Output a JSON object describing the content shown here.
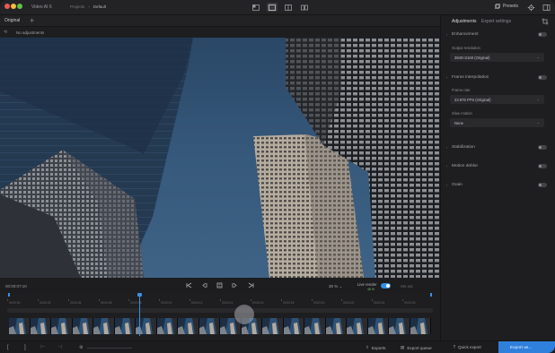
{
  "app": {
    "title": "Video AI 6"
  },
  "breadcrumbs": [
    "Projects",
    "›",
    "Default"
  ],
  "toolbar": {
    "presets_label": "Presets"
  },
  "preview": {
    "tab_label": "Original",
    "add_tab": "+",
    "adjust_status": "No adjustments"
  },
  "panel": {
    "tabs": [
      "Adjustments",
      "Export settings"
    ],
    "sections": {
      "enhancement": "Enhancement",
      "output_resolution_label": "Output resolution",
      "output_resolution_value": "3840×2160 (Original)",
      "frame_interpolation": "Frame interpolation",
      "frame_rate_label": "Frame rate",
      "frame_rate_value": "23.976 FPS (Original)",
      "slow_motion_label": "Slow motion",
      "slow_motion_value": "None",
      "stabilization": "Stabilization",
      "motion_deblur": "Motion deblur",
      "grain": "Grain"
    }
  },
  "transport": {
    "timecode": "00:00:07:10",
    "zoom": "30 %",
    "live_render": "Live render",
    "live_sub": "46 %",
    "set_out": "Set out"
  },
  "timeline": {
    "ticks": [
      "00:00:00",
      "00:00:02",
      "00:00:04",
      "00:00:06",
      "00:00:08",
      "00:00:10",
      "00:00:12",
      "00:00:14",
      "00:00:16",
      "00:00:18",
      "00:00:20",
      "00:00:22",
      "00:00:24",
      "00:00:26"
    ],
    "playhead_fraction": 0.31
  },
  "bottombar": {
    "exports": "Exports",
    "export_queue": "Export queue",
    "quick_export": "Quick export",
    "export_as": "Export as..."
  },
  "colors": {
    "accent": "#2f7fdc",
    "toggle_on": "#2f8fe6",
    "sky": "#2f5478"
  }
}
